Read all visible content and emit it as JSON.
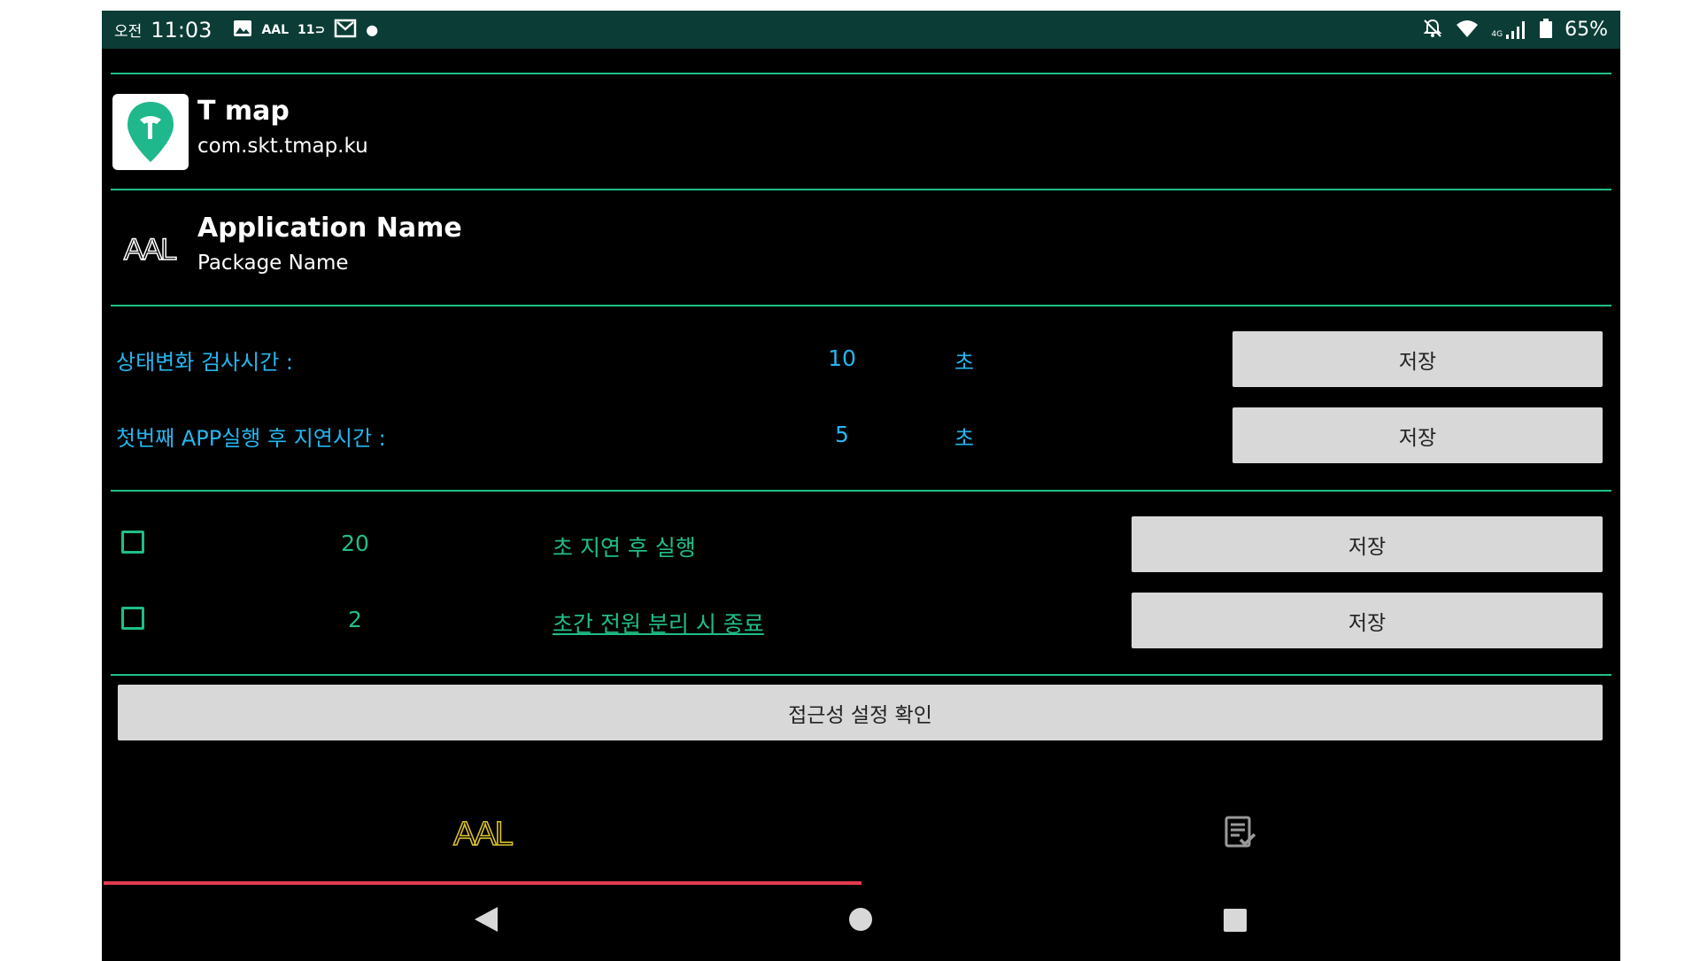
{
  "status_bar": {
    "ampm": "오전",
    "time": "11:03",
    "notif_aal": "AAL",
    "notif_11": "11",
    "battery": "65%",
    "network": "4G"
  },
  "app_selected": {
    "title": "T map",
    "package": "com.skt.tmap.ku",
    "icon": "tmap-pin-icon",
    "icon_color": "#1fb88c"
  },
  "app_self": {
    "logo": "AAL",
    "title": "Application Name",
    "package": "Package Name"
  },
  "settings": {
    "check_interval": {
      "label": "상태변화 검사시간 :",
      "value": "10",
      "unit": "초",
      "button": "저장"
    },
    "first_delay": {
      "label": "첫번째 APP실행 후 지연시간 :",
      "value": "5",
      "unit": "초",
      "button": "저장"
    }
  },
  "options": {
    "delayed_run": {
      "checked": false,
      "value": "20",
      "label": "초 지연 후 실행",
      "button": "저장"
    },
    "power_off_exit": {
      "checked": false,
      "value": "2",
      "label": "초간 전원 분리 시 종료",
      "button": "저장"
    }
  },
  "accessibility_button": "접근성 설정 확인",
  "tabs": [
    {
      "name": "aal-tab",
      "logo": "AAL",
      "active": true
    },
    {
      "name": "checklist-tab",
      "icon": "checklist-icon",
      "active": false
    }
  ],
  "colors": {
    "status_bar_bg": "#0c3c36",
    "accent_green": "#1fbf86",
    "accent_blue": "#25b6ee",
    "tab_indicator": "#e23b4e",
    "aal_yellow": "#d8c12a"
  }
}
